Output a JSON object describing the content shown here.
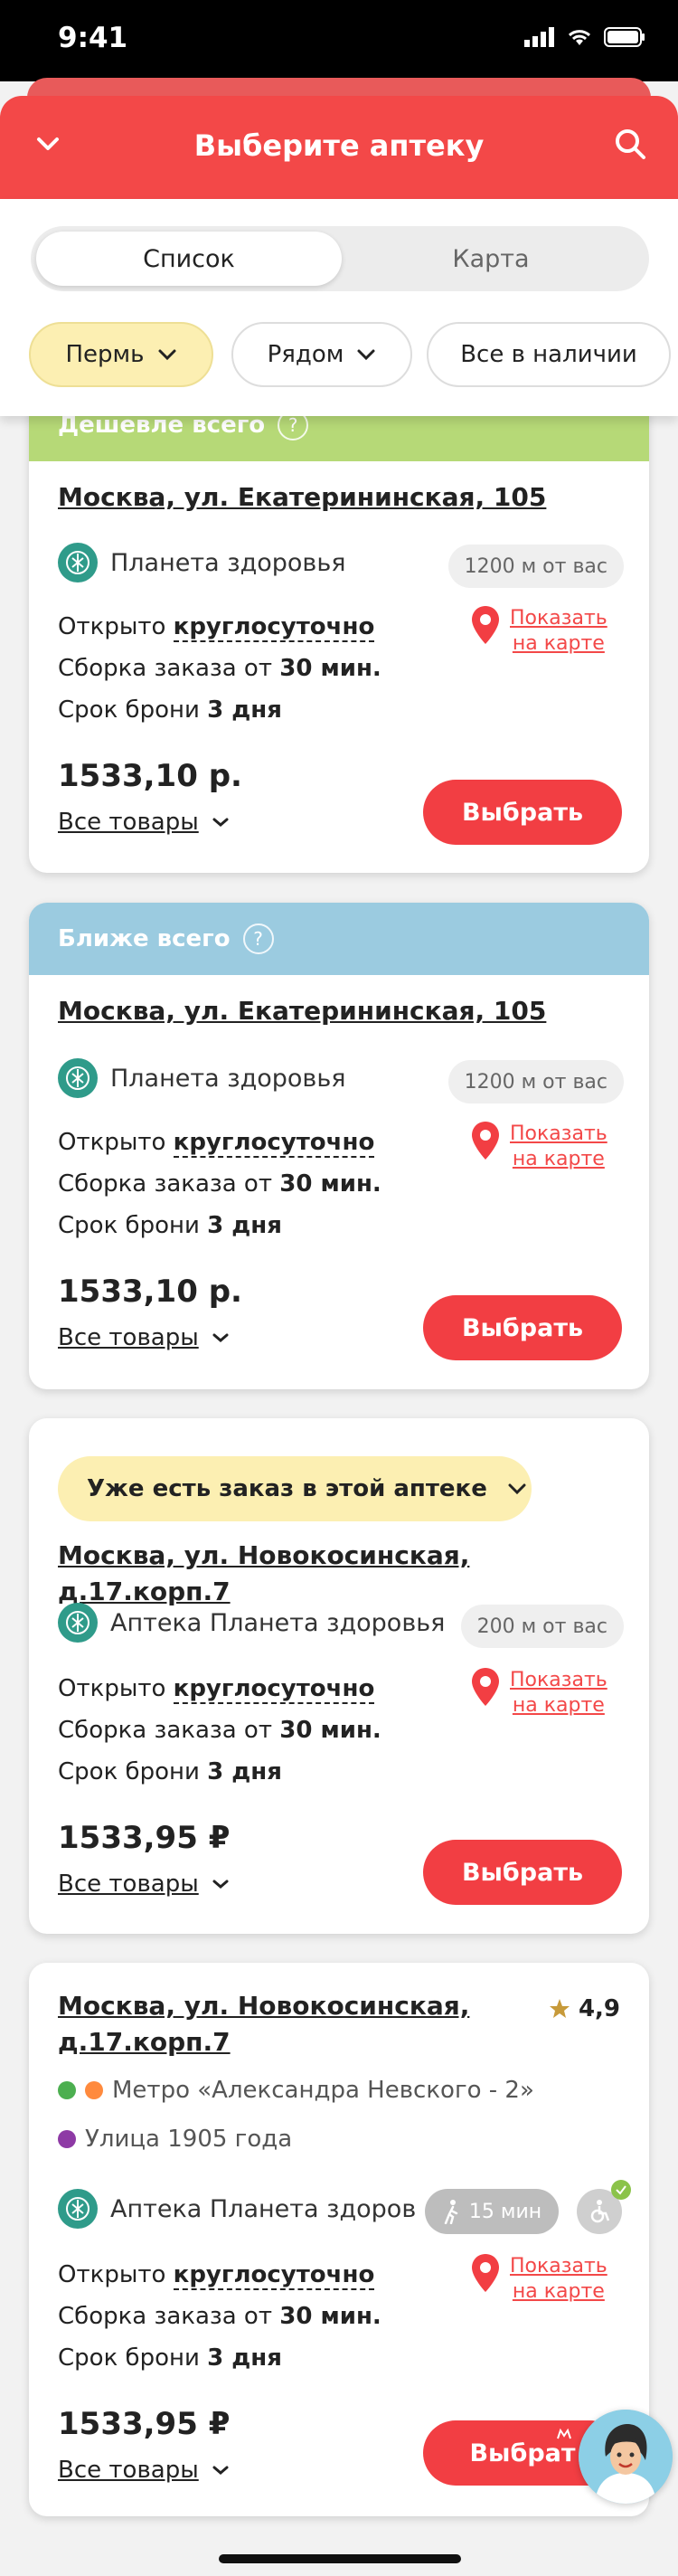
{
  "status": {
    "time": "9:41"
  },
  "header": {
    "title": "Выберите аптеку"
  },
  "tabs": {
    "list": "Список",
    "map": "Карта"
  },
  "filters": {
    "city": "Пермь",
    "near": "Рядом",
    "availability": "Все в наличии"
  },
  "colors": {
    "accent": "#f23e43",
    "cheapest": "#b6d977",
    "nearest": "#9bcbe0",
    "pill": "#fcefb2"
  },
  "cards": [
    {
      "banner": "Дешевле всего",
      "address": "Москва, ул. Екатерининская, 105",
      "pharmacy": "Планета здоровья",
      "distance": "1200 м от вас",
      "open_prefix": "Открыто ",
      "open_value": "круглосуточно",
      "assembly_prefix": "Сборка заказа от ",
      "assembly_value": "30 мин.",
      "reserve_prefix": "Срок брони ",
      "reserve_value": "3 дня",
      "map_link_1": "Показать",
      "map_link_2": "на карте",
      "price": "1533,10 р.",
      "all_items": "Все товары",
      "select": "Выбрать"
    },
    {
      "banner": "Ближе всего",
      "address": "Москва, ул. Екатерининская, 105",
      "pharmacy": "Планета здоровья",
      "distance": "1200 м от вас",
      "open_prefix": "Открыто ",
      "open_value": "круглосуточно",
      "assembly_prefix": "Сборка заказа от ",
      "assembly_value": "30 мин.",
      "reserve_prefix": "Срок брони ",
      "reserve_value": "3 дня",
      "map_link_1": "Показать",
      "map_link_2": "на карте",
      "price": "1533,10 р.",
      "all_items": "Все товары",
      "select": "Выбрать"
    },
    {
      "order_notice": "Уже есть заказ в этой аптеке",
      "address": "Москва, ул. Новокосинская, д.17.корп.7",
      "pharmacy": "Аптека Планета здоровья",
      "distance": "200 м от вас",
      "open_prefix": "Открыто ",
      "open_value": "круглосуточно",
      "assembly_prefix": "Сборка заказа от ",
      "assembly_value": "30 мин.",
      "reserve_prefix": "Срок брони ",
      "reserve_value": "3 дня",
      "map_link_1": "Показать",
      "map_link_2": "на карте",
      "price": "1533,95 ₽",
      "all_items": "Все товары",
      "select": "Выбрать"
    },
    {
      "address_line1": "Москва, ул. Новокосинская,",
      "address_line2": "д.17.корп.7",
      "rating": "4,9",
      "metro": "Метро «Александра Невского - 2»",
      "street": "Улица 1905 года",
      "pharmacy": "Аптека Планета здоров",
      "walk": "15 мин",
      "open_prefix": "Открыто ",
      "open_value": "круглосуточно",
      "assembly_prefix": "Сборка заказа от ",
      "assembly_value": "30 мин.",
      "reserve_prefix": "Срок брони ",
      "reserve_value": "3 дня",
      "map_link_1": "Показать",
      "map_link_2": "на карте",
      "price": "1533,95 ₽",
      "all_items": "Все товары",
      "select": "Выбрат"
    }
  ]
}
